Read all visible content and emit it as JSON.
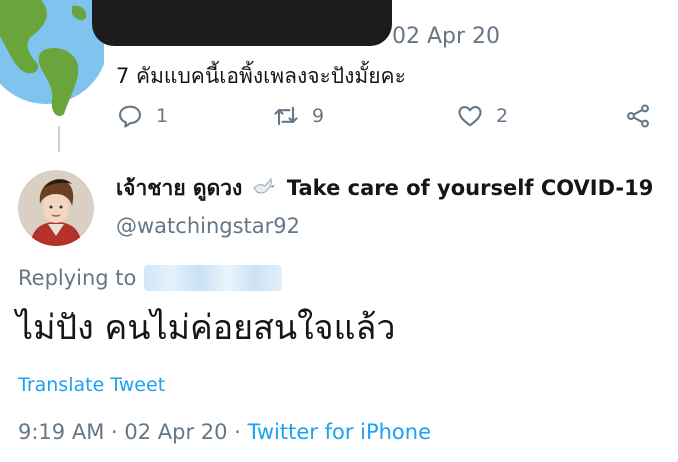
{
  "parent_tweet": {
    "date": "02 Apr 20",
    "text": "7 คัมแบคนี้เอพิ้งเพลงจะปังมั้ยคะ",
    "actions": {
      "reply_count": "1",
      "retweet_count": "9",
      "like_count": "2"
    }
  },
  "main_tweet": {
    "display_name": "เจ้าชาย ดูดวง",
    "display_name_suffix": "Take care of yourself COVID-19",
    "handle": "@watchingstar92",
    "replying_to_label": "Replying to",
    "text": "ไม่ปัง คนไม่ค่อยสนใจแล้ว",
    "translate_label": "Translate Tweet",
    "time": "9:19 AM",
    "date": "02 Apr 20",
    "source": "Twitter for iPhone",
    "separator": " · "
  },
  "colors": {
    "accent": "#1da1f2",
    "secondary_text": "#657786",
    "primary_text": "#14171a"
  },
  "icons": {
    "reply": "reply-icon",
    "retweet": "retweet-icon",
    "like": "like-icon",
    "share": "share-icon",
    "dove": "dove-emoji"
  }
}
